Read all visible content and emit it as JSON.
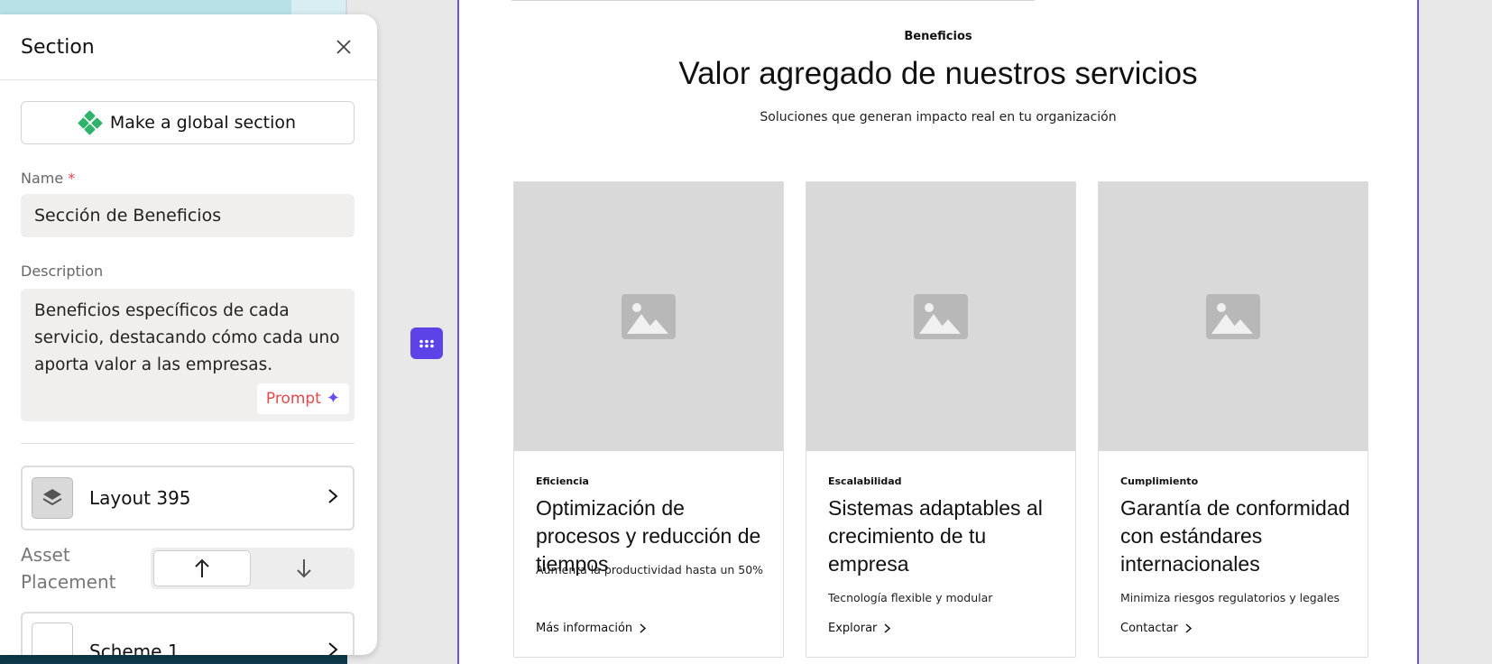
{
  "panel": {
    "title": "Section",
    "global_button_label": "Make a global section",
    "name_label": "Name",
    "required_mark": "*",
    "name_value": "Sección de Beneficios",
    "description_label": "Description",
    "description_value": "Beneficios específicos de cada servicio, destacando cómo cada uno aporta valor a las empresas.",
    "prompt_label": "Prompt",
    "layout_label": "Layout 395",
    "asset_placement_label": "Asset Placement",
    "scheme_label": "Scheme 1"
  },
  "canvas": {
    "eyebrow": "Beneficios",
    "headline": "Valor agregado de nuestros servicios",
    "subhead": "Soluciones que generan impacto real en tu organización",
    "cards": [
      {
        "tag": "Eficiencia",
        "title": "Optimización de procesos y reducción de tiempos",
        "description": "Aumenta la productividad hasta un 50%",
        "link": "Más información"
      },
      {
        "tag": "Escalabilidad",
        "title": "Sistemas adaptables al crecimiento de tu empresa",
        "description": "Tecnología flexible y modular",
        "link": "Explorar"
      },
      {
        "tag": "Cumplimiento",
        "title": "Garantía de conformidad con estándares internacionales",
        "description": "Minimiza riesgos regulatorios y legales",
        "link": "Contactar"
      }
    ]
  },
  "colors": {
    "accent": "#5b43e8",
    "canvas_border": "#6a55e8",
    "global_icon": "#2fb36b",
    "required": "#e5484d"
  },
  "icons": {
    "close": "close-icon",
    "global": "global-section-icon",
    "prompt": "sparkle-icon",
    "layout": "layers-icon",
    "chevron": "chevron-right-icon",
    "asset_up": "arrow-up-icon",
    "asset_down": "arrow-down-icon",
    "handle": "grid-dots-icon",
    "image": "image-placeholder-icon"
  }
}
